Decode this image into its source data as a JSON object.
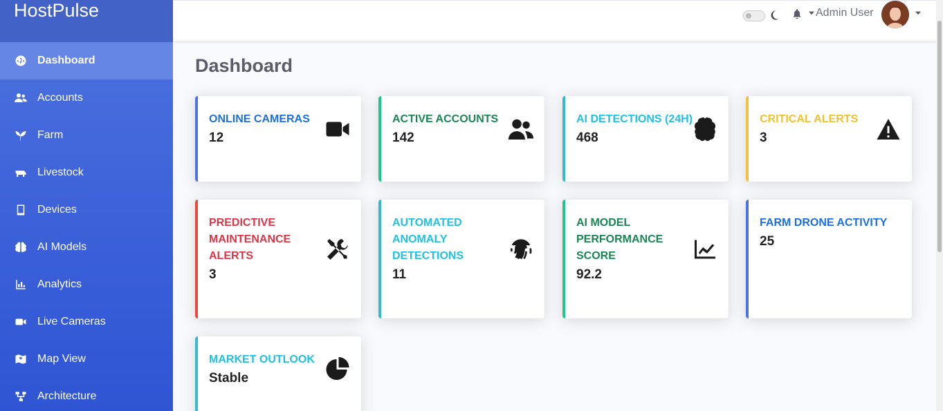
{
  "brand": "HostPulse",
  "sidebar": {
    "items": [
      {
        "label": "Dashboard",
        "icon": "gauge-icon",
        "active": true
      },
      {
        "label": "Accounts",
        "icon": "users-icon"
      },
      {
        "label": "Farm",
        "icon": "seedling-icon"
      },
      {
        "label": "Livestock",
        "icon": "cow-icon"
      },
      {
        "label": "Devices",
        "icon": "tablet-icon"
      },
      {
        "label": "AI Models",
        "icon": "brain-icon"
      },
      {
        "label": "Analytics",
        "icon": "chart-bar-icon"
      },
      {
        "label": "Live Cameras",
        "icon": "video-icon"
      },
      {
        "label": "Map View",
        "icon": "map-icon"
      },
      {
        "label": "Architecture",
        "icon": "sitemap-icon"
      }
    ]
  },
  "topbar": {
    "user_name": "Admin User"
  },
  "page_title": "Dashboard",
  "cards": [
    {
      "label": "ONLINE CAMERAS",
      "value": "12",
      "icon": "video-icon",
      "color": "primary"
    },
    {
      "label": "ACTIVE ACCOUNTS",
      "value": "142",
      "icon": "users-icon",
      "color": "success"
    },
    {
      "label": "AI DETECTIONS (24H)",
      "value": "468",
      "icon": "brain-icon",
      "color": "info"
    },
    {
      "label": "CRITICAL ALERTS",
      "value": "3",
      "icon": "warning-icon",
      "color": "warning"
    },
    {
      "label": "PREDICTIVE MAINTENANCE ALERTS",
      "value": "3",
      "icon": "tools-icon",
      "color": "danger"
    },
    {
      "label": "AUTOMATED ANOMALY DETECTIONS",
      "value": "11",
      "icon": "fingerprint-icon",
      "color": "info"
    },
    {
      "label": "AI MODEL PERFORMANCE SCORE",
      "value": "92.2",
      "icon": "chart-line-icon",
      "color": "success"
    },
    {
      "label": "FARM DRONE ACTIVITY",
      "value": "25",
      "icon": "",
      "color": "primary"
    },
    {
      "label": "MARKET OUTLOOK",
      "value": "Stable",
      "icon": "pie-chart-icon",
      "color": "info"
    }
  ],
  "colors": {
    "primary": "#4e73df",
    "success": "#1cc88a",
    "info": "#36b9cc",
    "warning": "#f6c23e",
    "danger": "#e74a3b"
  }
}
